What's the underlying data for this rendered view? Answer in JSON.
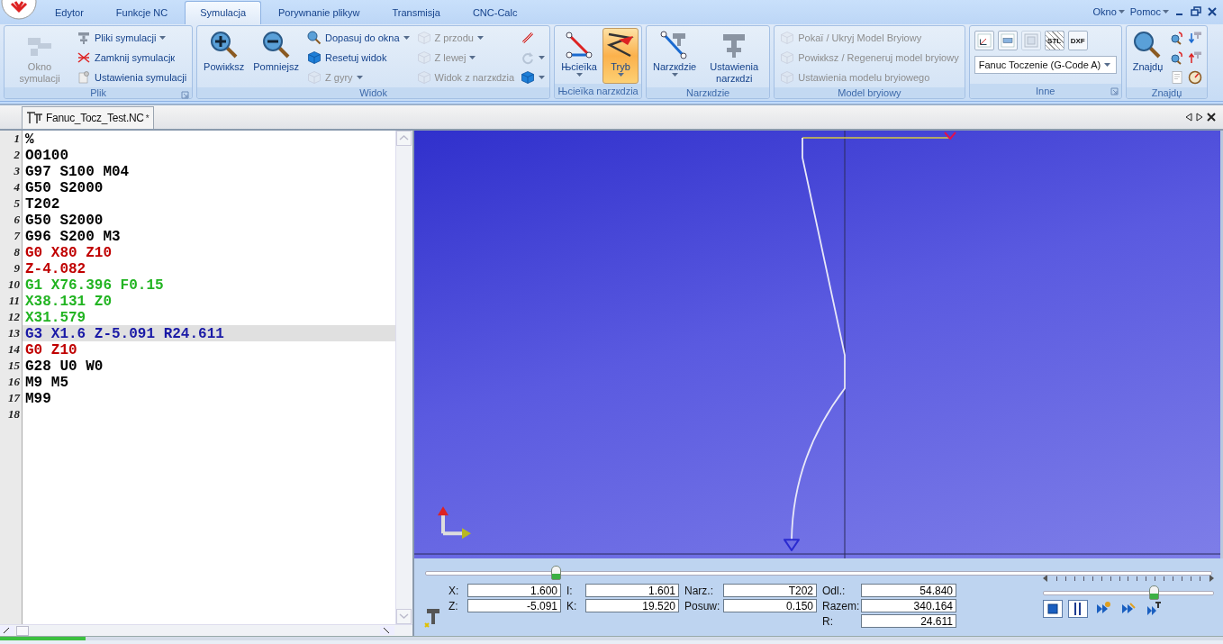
{
  "tabs": [
    {
      "label": "Edytor",
      "selected": false
    },
    {
      "label": "Funkcje NC",
      "selected": false
    },
    {
      "label": "Symulacja",
      "selected": true
    },
    {
      "label": "Porуwnanie plikуw",
      "selected": false
    },
    {
      "label": "Transmisja",
      "selected": false
    },
    {
      "label": "CNC-Calc",
      "selected": false
    }
  ],
  "window_menus": [
    {
      "label": "Okno"
    },
    {
      "label": "Pomoc"
    }
  ],
  "ribbon_groups": [
    {
      "title": "Plik",
      "launcher": true,
      "items": [
        {
          "kind": "large",
          "label": "Okno symulacji",
          "disabled": true,
          "dropdown": false,
          "pressed": false
        },
        {
          "kind": "column",
          "items": [
            {
              "kind": "small",
              "label": "Pliki symulacji",
              "disabled": false,
              "dropdown": true
            },
            {
              "kind": "small",
              "label": "Zamknij symulacjк",
              "disabled": false,
              "dropdown": false
            },
            {
              "kind": "small",
              "label": "Ustawienia symulacji",
              "disabled": false,
              "dropdown": false
            }
          ]
        }
      ]
    },
    {
      "title": "Widok",
      "launcher": false,
      "items": [
        {
          "kind": "large",
          "label": "Powiкksz",
          "disabled": false,
          "dropdown": false,
          "pressed": false
        },
        {
          "kind": "large",
          "label": "Pomniejsz",
          "disabled": false,
          "dropdown": false,
          "pressed": false
        },
        {
          "kind": "column",
          "items": [
            {
              "kind": "small",
              "label": "Dopasuj do okna",
              "disabled": false,
              "dropdown": true
            },
            {
              "kind": "small",
              "label": "Resetuj widok",
              "disabled": false,
              "dropdown": false
            },
            {
              "kind": "small",
              "label": "Z gуry",
              "disabled": true,
              "dropdown": true
            }
          ]
        },
        {
          "kind": "column",
          "items": [
            {
              "kind": "small",
              "label": "Z przodu",
              "disabled": true,
              "dropdown": true
            },
            {
              "kind": "small",
              "label": "Z lewej",
              "disabled": true,
              "dropdown": true
            },
            {
              "kind": "small",
              "label": "Widok z narzкdzia",
              "disabled": true,
              "dropdown": false
            }
          ]
        },
        {
          "kind": "column",
          "items": [
            {
              "kind": "small",
              "disabled": false,
              "dropdown": false
            },
            {
              "kind": "small",
              "disabled": true,
              "dropdown": true
            },
            {
              "kind": "small",
              "disabled": false,
              "dropdown": true
            }
          ]
        }
      ]
    },
    {
      "title": "Њcieїka narzкdzia",
      "launcher": false,
      "items": [
        {
          "kind": "large",
          "label": "Њcieїka",
          "disabled": false,
          "dropdown": true,
          "pressed": false
        },
        {
          "kind": "large",
          "label": "Tryb",
          "disabled": false,
          "dropdown": true,
          "pressed": true
        }
      ]
    },
    {
      "title": "Narzкdzie",
      "launcher": false,
      "items": [
        {
          "kind": "large",
          "label": "Narzкdzie",
          "disabled": false,
          "dropdown": true,
          "pressed": false
        },
        {
          "kind": "large",
          "label": "Ustawienia narzкdzi",
          "disabled": false,
          "dropdown": false,
          "pressed": false
        }
      ]
    },
    {
      "title": "Model bryіowy",
      "launcher": false,
      "items": [
        {
          "kind": "column",
          "items": [
            {
              "kind": "small",
              "label": "Pokaї / Ukryj Model Bryіowy",
              "disabled": true,
              "dropdown": false
            },
            {
              "kind": "small",
              "label": "Powiкksz / Regeneruj model bryіowy",
              "disabled": true,
              "dropdown": false
            },
            {
              "kind": "small",
              "label": "Ustawienia modelu bryіowego",
              "disabled": true,
              "dropdown": false
            }
          ]
        }
      ]
    },
    {
      "title": "Inne",
      "launcher": true,
      "items": [
        {
          "kind": "stack",
          "row": [
            {
              "kind": "tile",
              "disabled": false
            },
            {
              "kind": "tile",
              "disabled": false
            },
            {
              "kind": "tile",
              "disabled": true
            },
            {
              "kind": "tile",
              "caption": "STL",
              "disabled": false
            },
            {
              "kind": "tile",
              "caption": "DXF",
              "disabled": false
            }
          ],
          "combo": {
            "value": "Fanuc Toczenie (G-Code A)"
          }
        }
      ]
    },
    {
      "title": "Znajdџ",
      "launcher": false,
      "items": [
        {
          "kind": "large",
          "label": "Znajdџ",
          "disabled": false,
          "dropdown": false,
          "pressed": false
        },
        {
          "kind": "grid",
          "items": [
            {
              "kind": "small",
              "disabled": false,
              "dropdown": false
            },
            {
              "kind": "small",
              "disabled": false,
              "dropdown": false
            },
            {
              "kind": "small",
              "disabled": false,
              "dropdown": false
            },
            {
              "kind": "small",
              "disabled": false,
              "dropdown": false
            },
            {
              "kind": "small",
              "disabled": false,
              "dropdown": false
            },
            {
              "kind": "small",
              "disabled": false,
              "dropdown": false
            }
          ]
        }
      ]
    }
  ],
  "document_tab": {
    "title": "Fanuc_Tocz_Test.NC",
    "modified_mark": "*"
  },
  "editor_lines": [
    {
      "number": "1",
      "text": "%",
      "color": "#000000",
      "selected": false
    },
    {
      "number": "2",
      "text": "O0100",
      "color": "#000000",
      "selected": false
    },
    {
      "number": "3",
      "text": "G97 S100 M04",
      "color": "#000000",
      "selected": false
    },
    {
      "number": "4",
      "text": "G50 S2000",
      "color": "#000000",
      "selected": false
    },
    {
      "number": "5",
      "text": "T202",
      "color": "#000000",
      "selected": false
    },
    {
      "number": "6",
      "text": "G50 S2000",
      "color": "#000000",
      "selected": false
    },
    {
      "number": "7",
      "text": "G96 S200 M3",
      "color": "#000000",
      "selected": false
    },
    {
      "number": "8",
      "text": "G0 X80 Z10",
      "color": "#c00000",
      "selected": false
    },
    {
      "number": "9",
      "text": "Z-4.082",
      "color": "#c00000",
      "selected": false
    },
    {
      "number": "10",
      "text": "G1 X76.396 F0.15",
      "color": "#22b422",
      "selected": false
    },
    {
      "number": "11",
      "text": "X38.131 Z0",
      "color": "#22b422",
      "selected": false
    },
    {
      "number": "12",
      "text": "X31.579",
      "color": "#22b422",
      "selected": false
    },
    {
      "number": "13",
      "text": "G3 X1.6 Z-5.091 R24.611",
      "color": "#1a1aa6",
      "selected": true
    },
    {
      "number": "14",
      "text": "G0 Z10",
      "color": "#c00000",
      "selected": false
    },
    {
      "number": "15",
      "text": "G28 U0 W0",
      "color": "#000000",
      "selected": false
    },
    {
      "number": "16",
      "text": "M9 M5",
      "color": "#000000",
      "selected": false
    },
    {
      "number": "17",
      "text": "M99",
      "color": "#000000",
      "selected": false
    },
    {
      "number": "18",
      "selected": false
    }
  ],
  "position_slider": {
    "level": 0.165
  },
  "readouts": [
    [
      {
        "label": "X:",
        "value": "1.600"
      },
      {
        "label": "Z:",
        "value": "-5.091"
      }
    ],
    [
      {
        "label": "I:",
        "value": "1.601"
      },
      {
        "label": "K:",
        "value": "19.520"
      }
    ],
    [
      {
        "label": "Narz.:",
        "value": "T202"
      },
      {
        "label": "Posuw:",
        "value": "0.150"
      }
    ],
    [
      {
        "label": "Odl.:",
        "value": "54.840"
      },
      {
        "label": "Razem:",
        "value": "340.164"
      },
      {
        "label": "R:",
        "value": "24.611"
      }
    ]
  ],
  "speed_slider": {
    "level": 0.64
  },
  "playback_buttons": [
    {
      "kind": "stop",
      "pressed": true
    },
    {
      "kind": "pause",
      "pressed": true
    },
    {
      "kind": "step",
      "pressed": false
    },
    {
      "kind": "run",
      "pressed": false
    },
    {
      "kind": "run-to-tool",
      "pressed": false
    }
  ],
  "status_bar": {
    "progress": {
      "level": 0.07
    }
  }
}
